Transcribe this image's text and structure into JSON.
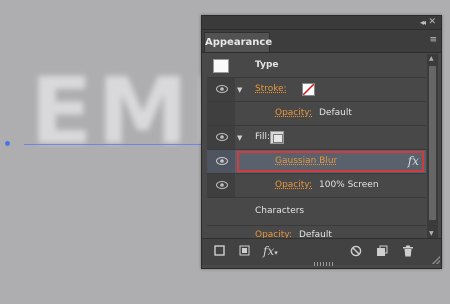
{
  "canvas": {
    "text": "EMB"
  },
  "panel": {
    "tab": "Appearance",
    "collapse_icon": "◂◂",
    "close_icon": "✕",
    "menu_icon": "≡"
  },
  "rows": [
    {
      "label": "Type"
    },
    {
      "label": "Stroke:"
    },
    {
      "label": "Opacity:",
      "value": "Default"
    },
    {
      "label": "Fill:"
    },
    {
      "label": "Gaussian Blur",
      "fx": "fx"
    },
    {
      "label": "Opacity:",
      "value": "100% Screen"
    },
    {
      "label": "Characters"
    },
    {
      "label": "Opacity:",
      "value": "Default"
    }
  ],
  "bottom": {
    "fx": "fx"
  },
  "colors": {
    "accent_orange": "#e8963c",
    "highlight_red": "#d23b3b",
    "selected_row": "#59616d"
  }
}
